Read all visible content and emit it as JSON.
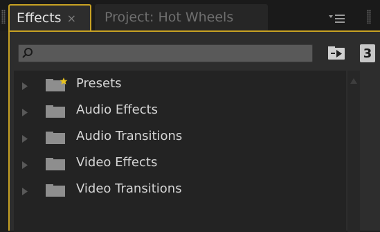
{
  "tabs": [
    {
      "label": "Effects",
      "active": true,
      "close_glyph": "×"
    },
    {
      "label": "Project: Hot Wheels",
      "active": false
    }
  ],
  "toolbar": {
    "search_value": "",
    "search_icon": "magnifier-icon",
    "new_bin_icon": "new-custom-bin-icon",
    "button_3_label": "3"
  },
  "tree": {
    "items": [
      {
        "label": "Presets",
        "icon": "folder-star-icon"
      },
      {
        "label": "Audio Effects",
        "icon": "folder-icon"
      },
      {
        "label": "Audio Transitions",
        "icon": "folder-icon"
      },
      {
        "label": "Video Effects",
        "icon": "folder-icon"
      },
      {
        "label": "Video Transitions",
        "icon": "folder-icon"
      }
    ]
  },
  "colors": {
    "accent": "#c8a223",
    "panel_bg": "#2d2d2d",
    "list_bg": "#232323",
    "text": "#d6d6d6"
  }
}
